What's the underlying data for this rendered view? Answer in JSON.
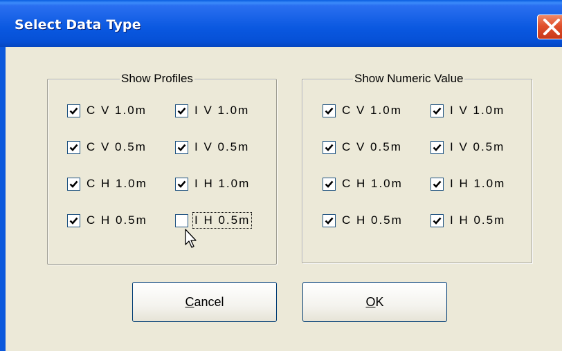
{
  "window": {
    "title": "Select Data Type",
    "close_icon": "close-x-icon"
  },
  "groups": [
    {
      "label": "Show Profiles",
      "items": [
        {
          "label": "C V 1.0m",
          "checked": true
        },
        {
          "label": "I V 1.0m",
          "checked": true
        },
        {
          "label": "C V 0.5m",
          "checked": true
        },
        {
          "label": "I V 0.5m",
          "checked": true
        },
        {
          "label": "C H 1.0m",
          "checked": true
        },
        {
          "label": "I H 1.0m",
          "checked": true
        },
        {
          "label": "C H 0.5m",
          "checked": true
        },
        {
          "label": "I H 0.5m",
          "checked": false,
          "focused": true
        }
      ]
    },
    {
      "label": "Show Numeric Value",
      "items": [
        {
          "label": "C V 1.0m",
          "checked": true
        },
        {
          "label": "I V 1.0m",
          "checked": true
        },
        {
          "label": "C V 0.5m",
          "checked": true
        },
        {
          "label": "I V 0.5m",
          "checked": true
        },
        {
          "label": "C H 1.0m",
          "checked": true
        },
        {
          "label": "I H 1.0m",
          "checked": true
        },
        {
          "label": "C H 0.5m",
          "checked": true
        },
        {
          "label": "I H 0.5m",
          "checked": true
        }
      ]
    }
  ],
  "buttons": {
    "cancel": {
      "mnemonic": "C",
      "rest": "ancel"
    },
    "ok": {
      "mnemonic": "O",
      "rest": "K"
    }
  },
  "colors": {
    "titlebar": "#0a58e0",
    "dialog_bg": "#ece9d8",
    "close_button": "#e0502c",
    "checkbox_border": "#1c5180"
  }
}
